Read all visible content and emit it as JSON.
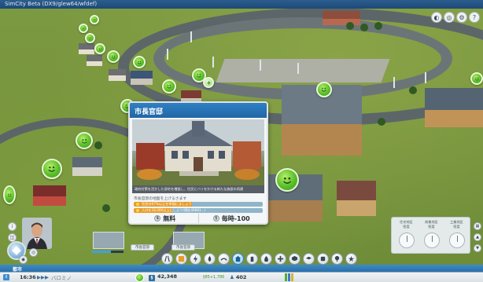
{
  "window": {
    "title": "SimCity Beta (DX9/glew64/wfdef)"
  },
  "colors": {
    "accent": "#2f7fc4",
    "happy": "#59bf2a",
    "progress": "#e79c2a",
    "grass": "#7c9a41",
    "road": "#5c6669"
  },
  "top_controls": {
    "items": [
      {
        "icon": "speed-icon",
        "glyph": "◐"
      },
      {
        "icon": "camera-icon",
        "glyph": "◎"
      },
      {
        "icon": "settings-icon",
        "glyph": "⚙"
      },
      {
        "icon": "help-icon",
        "glyph": "?"
      }
    ]
  },
  "popup": {
    "title": "市長官邸",
    "description": "政府対策を活かした邸宅を増設し、住民にハリをかける新たな施設の再建",
    "goal_label": "市長官邸の地盤を上げるさます",
    "progress": [
      {
        "label": "住民の67%以上を幸福にましょう",
        "percent": 45
      },
      {
        "label": "人口を18,000以上にしよう(現在49881...)",
        "percent": 30
      }
    ],
    "cost_label": "無料",
    "cost_icon": "$",
    "upkeep_label": "毎時-100",
    "upkeep_icon": "§"
  },
  "bottom_tray": {
    "buttons": [
      {
        "label": "市長官邸"
      },
      {
        "label": "市長官邸"
      }
    ]
  },
  "right_panel": {
    "columns": [
      {
        "label": "住宅地区\n密度"
      },
      {
        "label": "商業地区\n密度"
      },
      {
        "label": "工業地区\n密度"
      }
    ]
  },
  "toolbar": {
    "tools": [
      {
        "name": "road-tool",
        "icon": "road-icon"
      },
      {
        "name": "zone-tool",
        "icon": "zone-icon"
      },
      {
        "name": "power-tool",
        "icon": "power-icon"
      },
      {
        "name": "water-tool",
        "icon": "water-icon"
      },
      {
        "name": "sewage-tool",
        "icon": "sewage-icon"
      },
      {
        "name": "city-hall-tool",
        "icon": "city-hall-icon"
      },
      {
        "name": "waste-tool",
        "icon": "waste-icon"
      },
      {
        "name": "fire-tool",
        "icon": "fire-icon"
      },
      {
        "name": "health-tool",
        "icon": "health-icon"
      },
      {
        "name": "police-tool",
        "icon": "police-icon"
      },
      {
        "name": "education-tool",
        "icon": "education-icon"
      },
      {
        "name": "transit-tool",
        "icon": "transit-icon"
      },
      {
        "name": "parks-tool",
        "icon": "parks-icon"
      },
      {
        "name": "specialization-tool",
        "icon": "specialization-icon"
      }
    ],
    "active_index": 5
  },
  "city_tab": {
    "name": "都市"
  },
  "status": {
    "time": "16:36",
    "speed": "▶▶▶",
    "sim_label": "バロミノ",
    "money": "42,348",
    "income": "§85+1,786",
    "population": "402"
  }
}
